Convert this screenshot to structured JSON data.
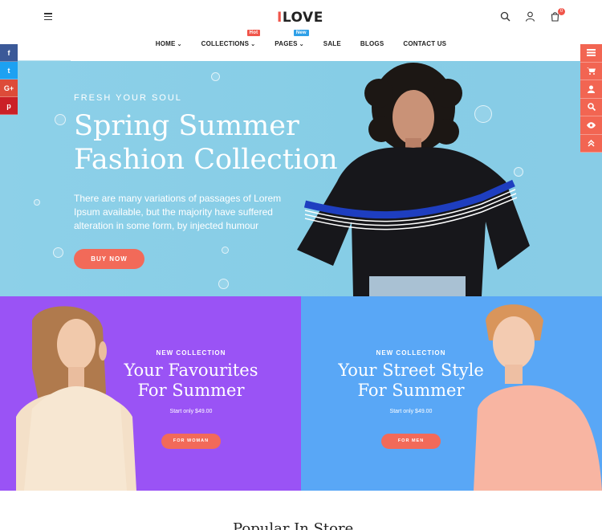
{
  "header": {
    "logo_accent": "I",
    "logo_text": "LOVE",
    "cart_count": "0"
  },
  "nav": {
    "items": [
      {
        "label": "HOME",
        "has_dropdown": true
      },
      {
        "label": "COLLECTIONS",
        "has_dropdown": true,
        "badge": "Hot"
      },
      {
        "label": "PAGES",
        "has_dropdown": true,
        "badge": "New"
      },
      {
        "label": "SALE",
        "has_dropdown": false
      },
      {
        "label": "BLOGS",
        "has_dropdown": false
      },
      {
        "label": "CONTACT US",
        "has_dropdown": false
      }
    ]
  },
  "hero": {
    "eyebrow": "FRESH YOUR SOUL",
    "title_line1": "Spring Summer",
    "title_line2": "Fashion Collection",
    "text": "There are many variations of passages of Lorem Ipsum available, but the majority have suffered alteration in some form, by injected humour",
    "button": "BUY NOW"
  },
  "social": {
    "facebook": "f",
    "twitter": "t",
    "google": "G+",
    "pinterest": "p"
  },
  "banners": {
    "left": {
      "eyebrow": "NEW COLLECTION",
      "title_line1": "Your Favourites",
      "title_line2": "For Summer",
      "price": "Start only $49.00",
      "button": "FOR WOMAN"
    },
    "right": {
      "eyebrow": "NEW COLLECTION",
      "title_line1": "Your Street Style",
      "title_line2": "For Summer",
      "price": "Start only $49.00",
      "button": "FOR MEN"
    }
  },
  "section": {
    "title": "Popular In Store"
  },
  "colors": {
    "accent": "#f26a59",
    "hero_bg": "#8dd0e8",
    "banner_left": "#9a53f5",
    "banner_right": "#59a7f6"
  }
}
